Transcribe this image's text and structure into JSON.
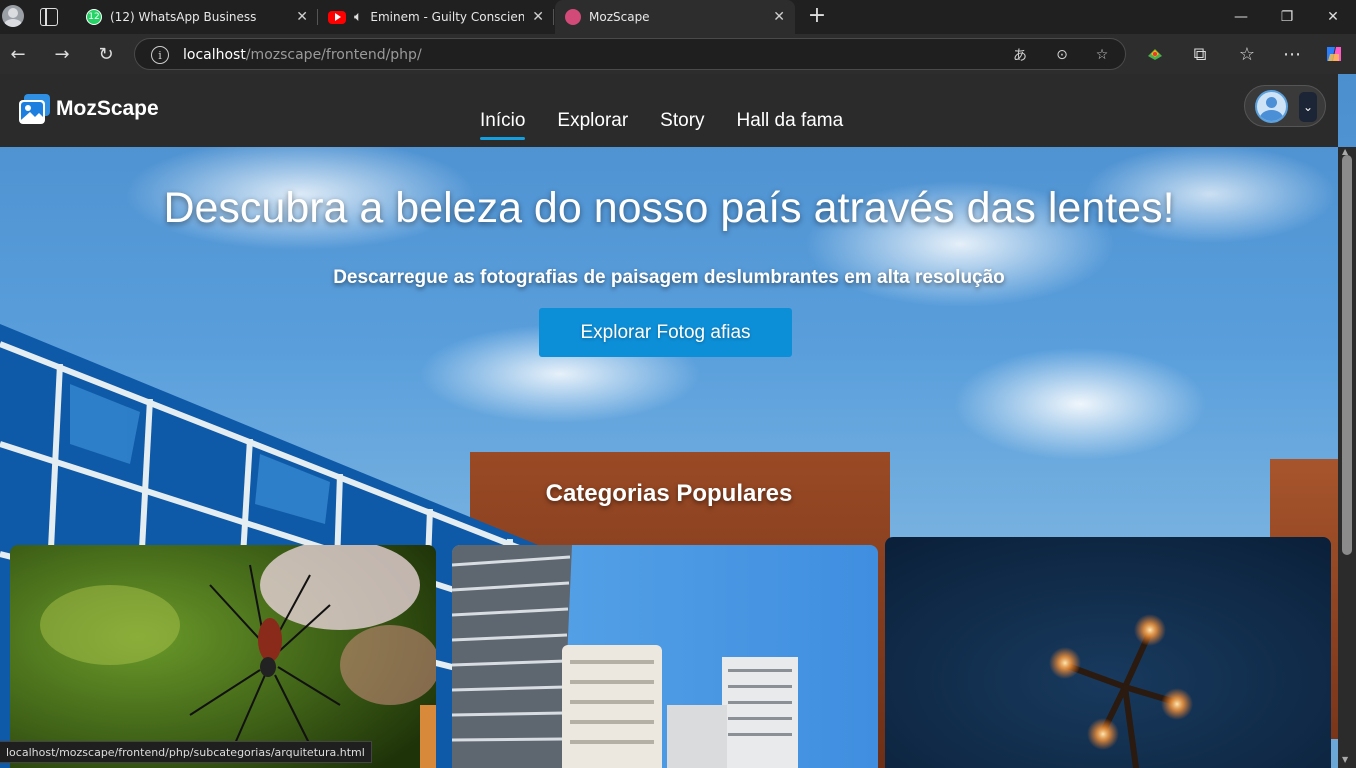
{
  "browser": {
    "tabs": [
      {
        "title": "(12) WhatsApp Business",
        "icon": "whatsapp-icon",
        "badge": "12"
      },
      {
        "title": "Eminem - Guilty Conscience",
        "icon": "youtube-icon"
      },
      {
        "title": "MozScape",
        "icon": "mozscape-icon",
        "active": true
      }
    ],
    "new_tab_glyph": "+",
    "url_host": "localhost",
    "url_path": "/mozscape/frontend/php/",
    "status_url": "localhost/mozscape/frontend/php/subcategorias/arquitetura.html"
  },
  "site": {
    "brand": "MozScape",
    "nav": [
      "Início",
      "Explorar",
      "Story",
      "Hall da fama"
    ],
    "active_nav": "Início"
  },
  "hero": {
    "title": "Descubra a beleza do nosso país através das lentes!",
    "subtitle": "Descarregue as fotografias de paisagem deslumbrantes em alta resolução",
    "button": "Explorar Fotog afias"
  },
  "categories": {
    "title": "Categorias Populares",
    "cards": [
      "spider-photo",
      "buildings-photo",
      "street-lamp-photo"
    ]
  },
  "colors": {
    "accent": "#0d8fd8",
    "navbar": "#2b2b2b",
    "nav_underline": "#14a0e0"
  }
}
